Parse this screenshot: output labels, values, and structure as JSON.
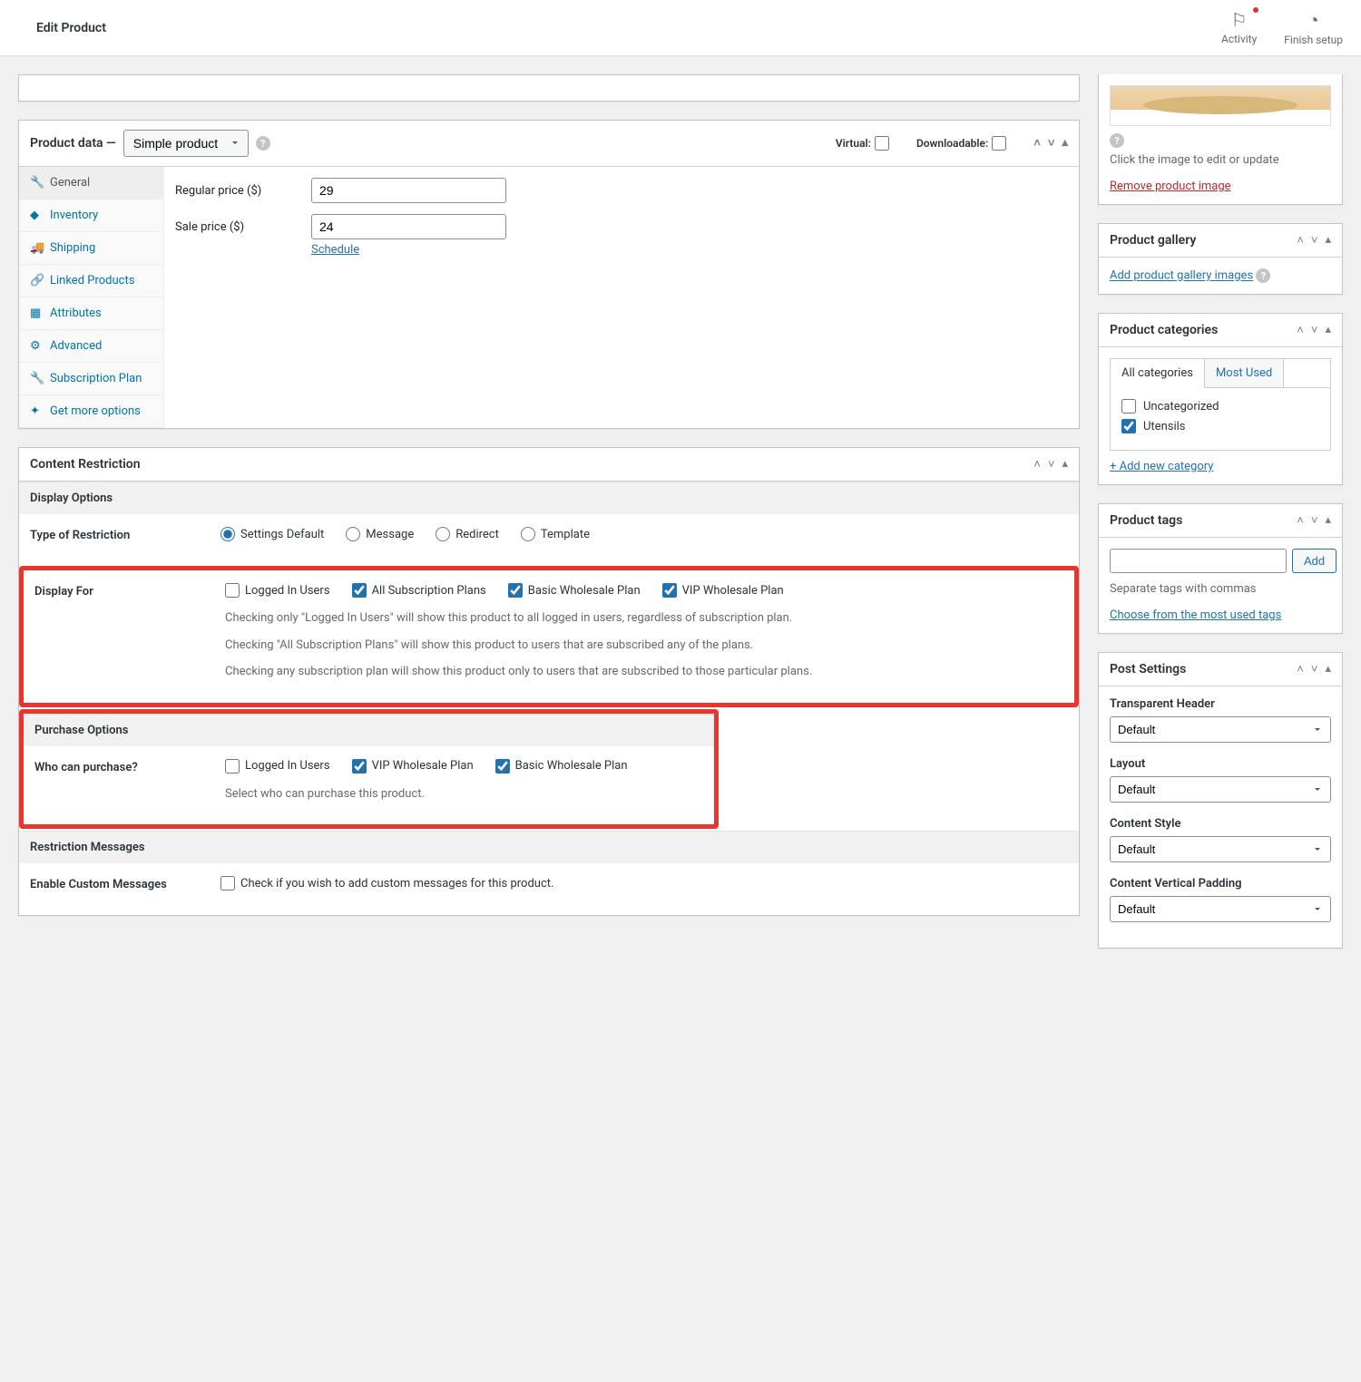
{
  "header": {
    "title": "Edit Product",
    "activity": "Activity",
    "finish_setup": "Finish setup"
  },
  "product_data": {
    "heading": "Product data —",
    "selected_type": "Simple product",
    "virtual_label": "Virtual:",
    "downloadable_label": "Downloadable:",
    "tabs": {
      "general": "General",
      "inventory": "Inventory",
      "shipping": "Shipping",
      "linked": "Linked Products",
      "attributes": "Attributes",
      "advanced": "Advanced",
      "subscription": "Subscription Plan",
      "more": "Get more options"
    },
    "general_panel": {
      "regular_price_label": "Regular price ($)",
      "regular_price_value": "29",
      "sale_price_label": "Sale price ($)",
      "sale_price_value": "24",
      "schedule": "Schedule"
    }
  },
  "content_restriction": {
    "heading": "Content Restriction",
    "display_options_heading": "Display Options",
    "type_label": "Type of Restriction",
    "type_options": {
      "settings_default": "Settings Default",
      "message": "Message",
      "redirect": "Redirect",
      "template": "Template"
    },
    "display_for_label": "Display For",
    "display_for_options": {
      "logged_in": "Logged In Users",
      "all_plans": "All Subscription Plans",
      "basic": "Basic Wholesale Plan",
      "vip": "VIP Wholesale Plan"
    },
    "help1": "Checking only \"Logged In Users\" will show this product to all logged in users, regardless of subscription plan.",
    "help2": "Checking \"All Subscription Plans\" will show this product to users that are subscribed any of the plans.",
    "help3": "Checking any subscription plan will show this product only to users that are subscribed to those particular plans.",
    "purchase_heading": "Purchase Options",
    "who_can_purchase_label": "Who can purchase?",
    "purchase_options": {
      "logged_in": "Logged In Users",
      "vip": "VIP Wholesale Plan",
      "basic": "Basic Wholesale Plan"
    },
    "purchase_help": "Select who can purchase this product.",
    "restriction_messages_heading": "Restriction Messages",
    "enable_custom_label": "Enable Custom Messages",
    "enable_custom_help": "Check if you wish to add custom messages for this product."
  },
  "sidebar": {
    "product_image": {
      "click_text": "Click the image to edit or update",
      "remove_text": "Remove product image"
    },
    "gallery": {
      "heading": "Product gallery",
      "add_link": "Add product gallery images"
    },
    "categories": {
      "heading": "Product categories",
      "tab_all": "All categories",
      "tab_most": "Most Used",
      "uncategorized": "Uncategorized",
      "utensils": "Utensils",
      "add_new": "+ Add new category"
    },
    "tags": {
      "heading": "Product tags",
      "add_btn": "Add",
      "separate_text": "Separate tags with commas",
      "choose_text": "Choose from the most used tags"
    },
    "post_settings": {
      "heading": "Post Settings",
      "transparent_header": "Transparent Header",
      "layout": "Layout",
      "content_style": "Content Style",
      "vertical_padding": "Content Vertical Padding",
      "default": "Default"
    }
  }
}
